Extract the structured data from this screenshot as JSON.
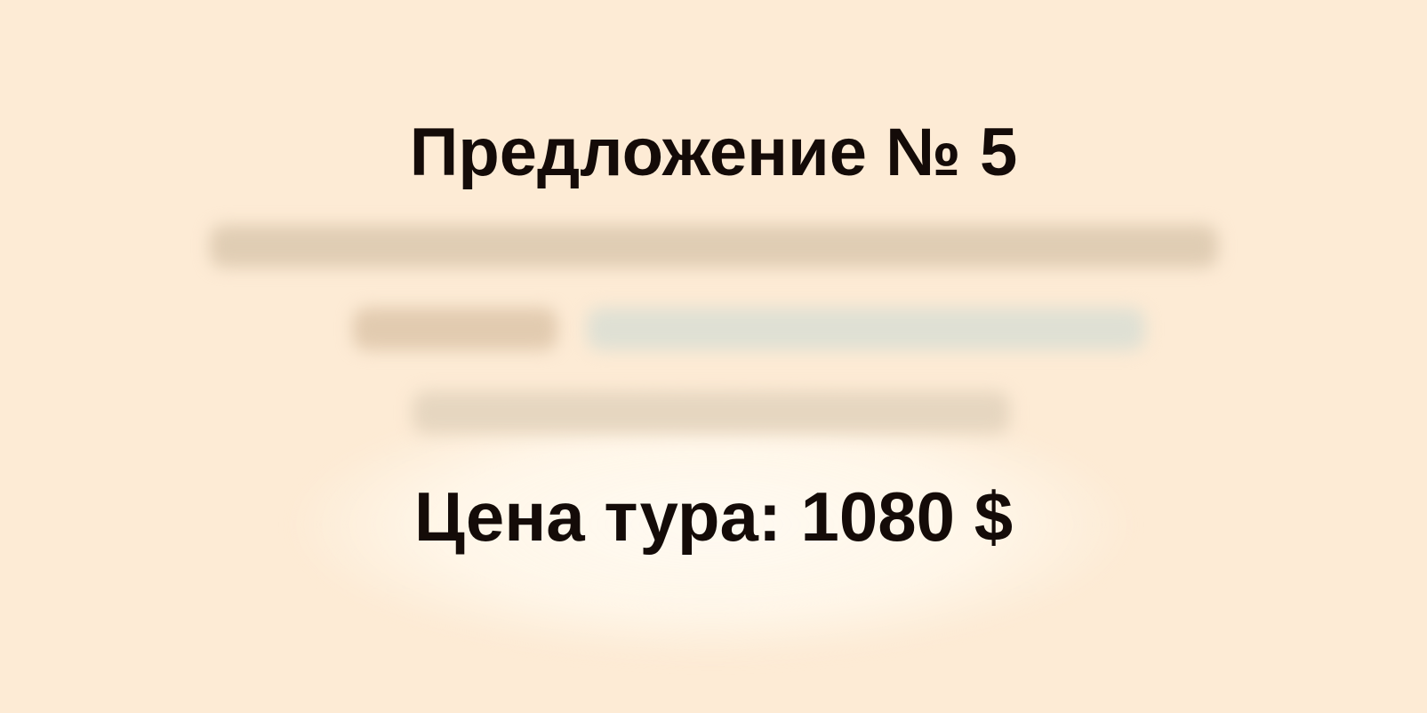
{
  "title": "Предложение № 5",
  "price_text": "Цена тура: 1080 $",
  "colors": {
    "background": "#fdebd5",
    "text": "#140b08",
    "blurred_line_warm": "#e0cdb4",
    "blurred_line_cool": "#dfe0d4"
  }
}
